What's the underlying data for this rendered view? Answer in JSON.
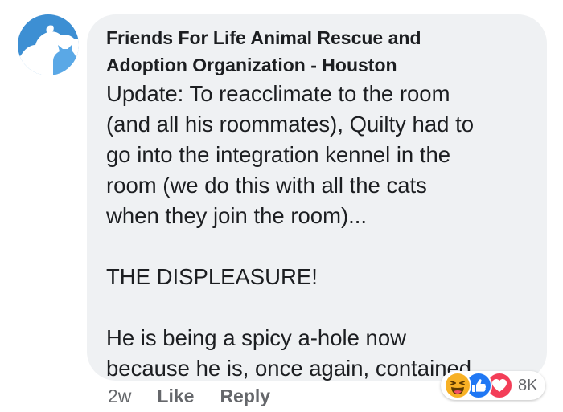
{
  "comment": {
    "author": {
      "line1": "Friends For Life Animal Rescue and",
      "line2": "Adoption Organization - Houston",
      "avatar_icon": "dog-cat-silhouette-icon",
      "avatar_color": "#3d8fd3"
    },
    "body": {
      "para1_lines": [
        "Update: To reacclimate to the room",
        "(and all his roommates), Quilty had to",
        "go into the integration kennel in the",
        "room (we do this with all the cats",
        "when they join the room)..."
      ],
      "para2": "THE DISPLEASURE!",
      "para3_lines": [
        "He is being a spicy a-hole now",
        "because he is, once again, contained..."
      ]
    },
    "actions": {
      "timestamp": "2w",
      "like_label": "Like",
      "reply_label": "Reply"
    },
    "reactions": {
      "icons": [
        "haha-icon",
        "like-icon",
        "love-icon"
      ],
      "colors": {
        "haha": "#f7b125",
        "like": "#2078f4",
        "love": "#f33e58"
      },
      "count": "8K"
    }
  }
}
